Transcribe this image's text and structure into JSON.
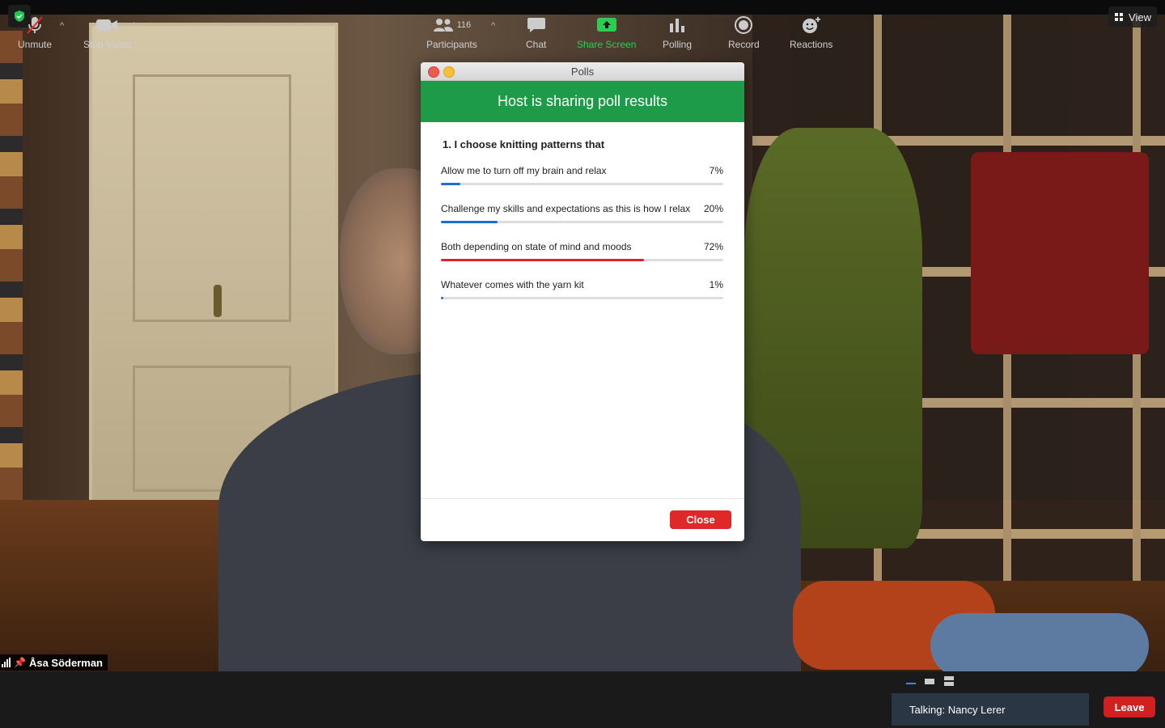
{
  "window": {
    "view_label": "View"
  },
  "participant": {
    "name": "Åsa Söderman"
  },
  "poll": {
    "window_title": "Polls",
    "banner": "Host is sharing poll results",
    "question": "1. I choose knitting patterns that",
    "answers": [
      {
        "label": "Allow me to turn off my brain and relax",
        "percent_label": "7%",
        "percent": 7,
        "color": "#1a6fd4"
      },
      {
        "label": "Challenge my skills and expectations as this is how I relax",
        "percent_label": "20%",
        "percent": 20,
        "color": "#1a6fd4"
      },
      {
        "label": "Both depending on state of mind and moods",
        "percent_label": "72%",
        "percent": 72,
        "color": "#d9262b"
      },
      {
        "label": "Whatever comes with the yarn kit",
        "percent_label": "1%",
        "percent": 1,
        "color": "#1a6fd4"
      }
    ],
    "close_label": "Close"
  },
  "toolbar": {
    "unmute": "Unmute",
    "stop_video": "Stop Video",
    "participants": "Participants",
    "participants_count": "116",
    "chat": "Chat",
    "share_screen": "Share Screen",
    "polling": "Polling",
    "record": "Record",
    "reactions": "Reactions",
    "talking": "Talking: Nancy Lerer",
    "leave": "Leave"
  },
  "colors": {
    "share_green": "#2ecc52",
    "leave_red": "#d02020",
    "banner_green": "#1d9b48"
  }
}
